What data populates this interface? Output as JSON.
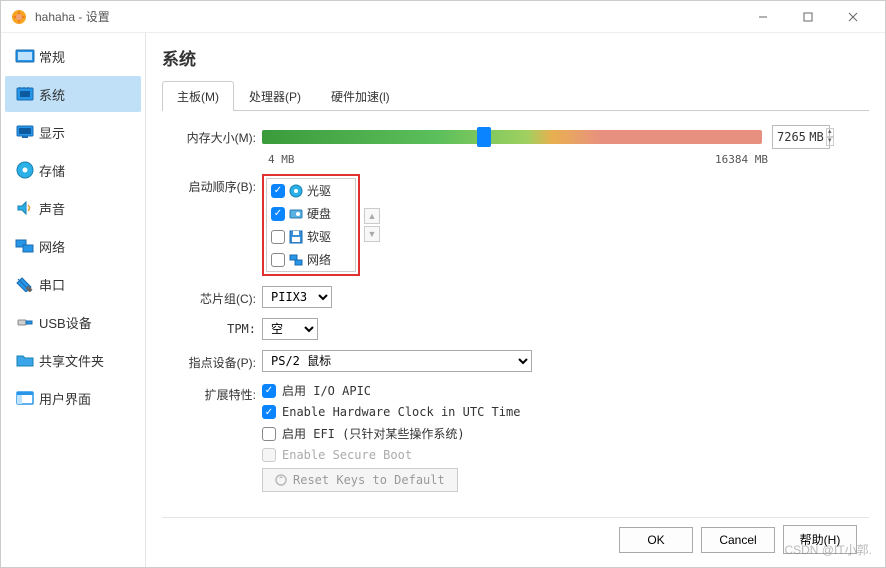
{
  "window": {
    "title": "hahaha - 设置"
  },
  "sidebar": {
    "items": [
      {
        "label": "常规"
      },
      {
        "label": "系统"
      },
      {
        "label": "显示"
      },
      {
        "label": "存储"
      },
      {
        "label": "声音"
      },
      {
        "label": "网络"
      },
      {
        "label": "串口"
      },
      {
        "label": "USB设备"
      },
      {
        "label": "共享文件夹"
      },
      {
        "label": "用户界面"
      }
    ]
  },
  "main": {
    "heading": "系统",
    "tabs": [
      {
        "label": "主板(M)"
      },
      {
        "label": "处理器(P)"
      },
      {
        "label": "硬件加速(l)"
      }
    ],
    "memory": {
      "label": "内存大小(M):",
      "value": "7265",
      "unit": "MB",
      "scale_min": "4 MB",
      "scale_max": "16384 MB"
    },
    "boot": {
      "label": "启动顺序(B):",
      "items": [
        {
          "label": "光驱",
          "checked": true
        },
        {
          "label": "硬盘",
          "checked": true
        },
        {
          "label": "软驱",
          "checked": false
        },
        {
          "label": "网络",
          "checked": false
        }
      ]
    },
    "chipset": {
      "label": "芯片组(C):",
      "value": "PIIX3"
    },
    "tpm": {
      "label": "TPM:",
      "value": "空"
    },
    "pointing": {
      "label": "指点设备(P):",
      "value": "PS/2 鼠标"
    },
    "ext": {
      "label": "扩展特性:",
      "opts": [
        {
          "label": "启用 I/O APIC",
          "checked": true,
          "disabled": false
        },
        {
          "label": "Enable Hardware Clock in UTC Time",
          "checked": true,
          "disabled": false
        },
        {
          "label": "启用 EFI (只针对某些操作系统)",
          "checked": false,
          "disabled": false
        },
        {
          "label": "Enable Secure Boot",
          "checked": false,
          "disabled": true
        }
      ],
      "reset": "Reset Keys to Default"
    }
  },
  "footer": {
    "ok": "OK",
    "cancel": "Cancel",
    "help": "帮助(H)"
  },
  "watermark": "CSDN @IT小郭."
}
